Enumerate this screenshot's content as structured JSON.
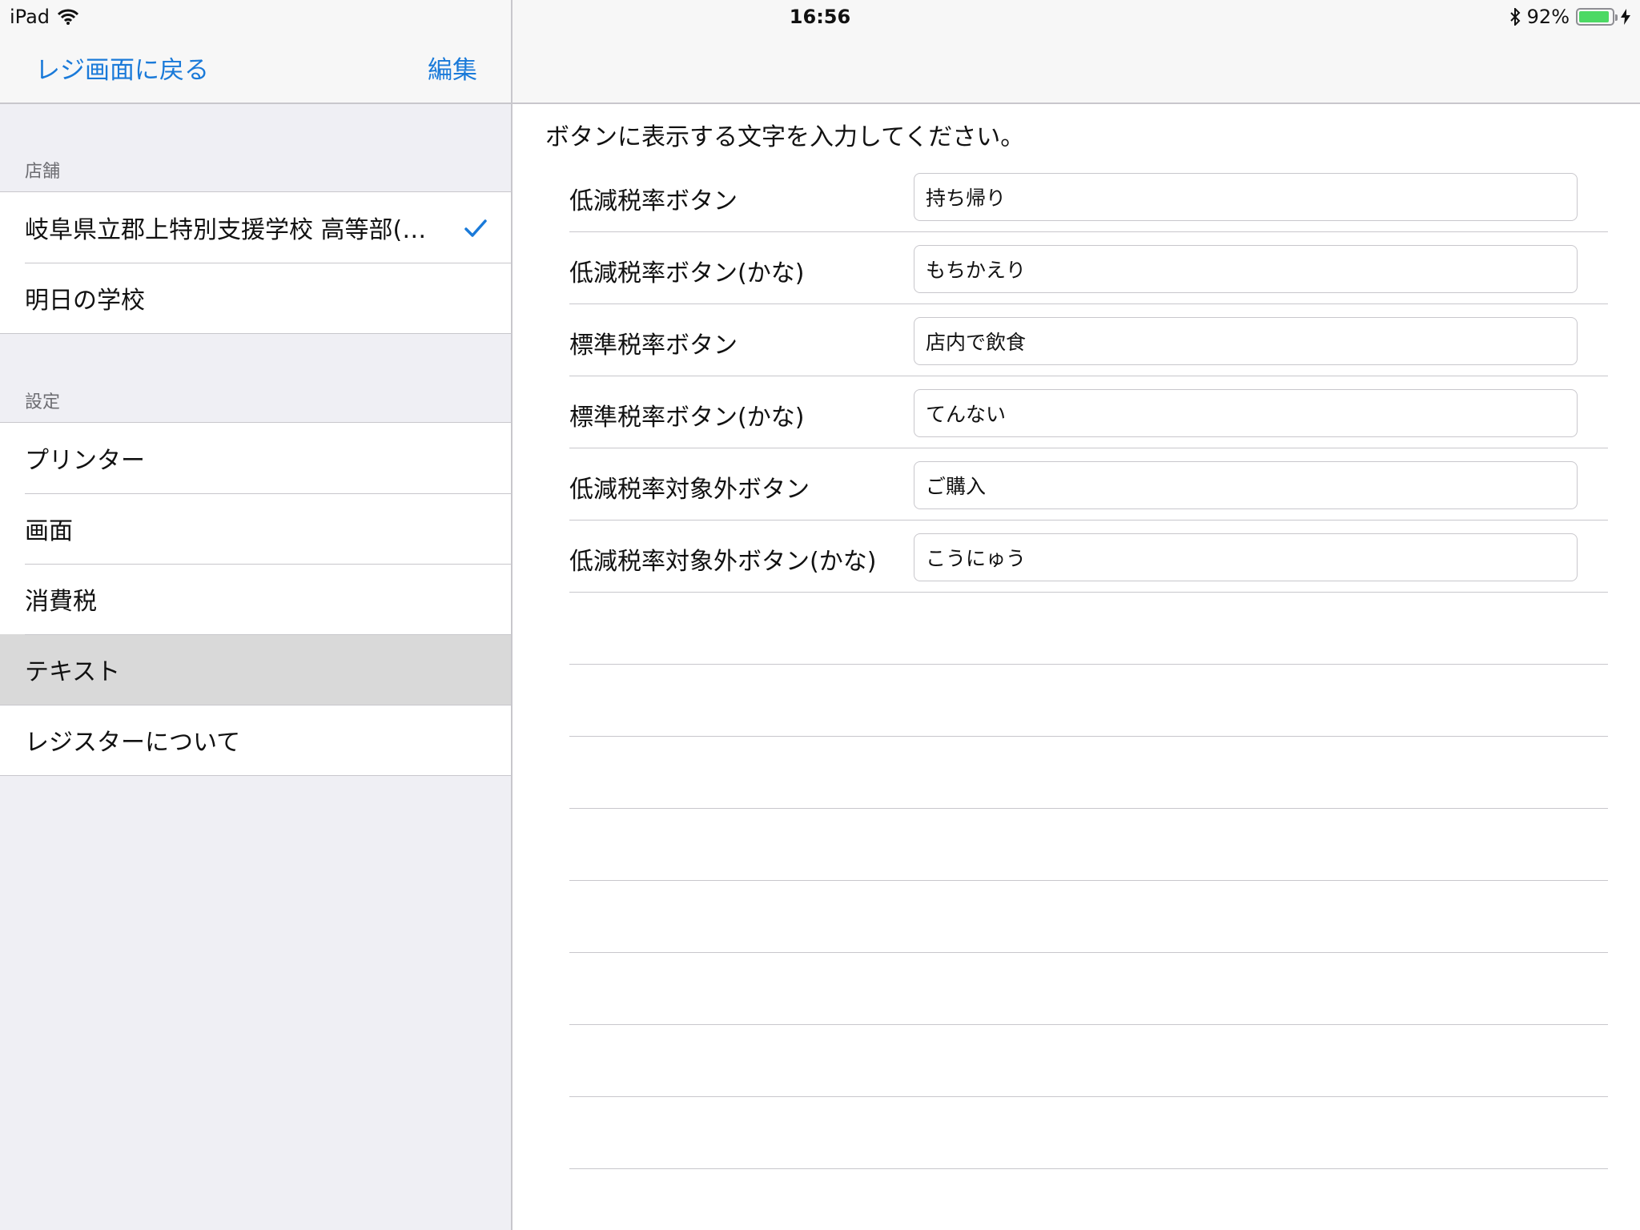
{
  "status_bar": {
    "device": "iPad",
    "time": "16:56",
    "battery_percent": "92%",
    "battery_level": 0.92,
    "icons": [
      "wifi-icon",
      "bluetooth-icon",
      "battery-icon",
      "charging-bolt-icon"
    ],
    "battery_color": "#4cd964"
  },
  "master": {
    "back_label": "レジ画面に戻る",
    "edit_label": "編集",
    "accent_color": "#1a7ad9",
    "stores_header": "店舗",
    "stores": [
      {
        "label": "岐阜県立郡上特別支援学校 高等部(…",
        "checked": true
      },
      {
        "label": "明日の学校",
        "checked": false
      }
    ],
    "settings_header": "設定",
    "settings": [
      {
        "label": "プリンター"
      },
      {
        "label": "画面"
      },
      {
        "label": "消費税"
      },
      {
        "label": "テキスト",
        "selected": true
      },
      {
        "label": "レジスターについて"
      }
    ]
  },
  "detail": {
    "instruction": "ボタンに表示する文字を入力してください。",
    "fields": [
      {
        "label": "低減税率ボタン",
        "value": "持ち帰り"
      },
      {
        "label": "低減税率ボタン(かな)",
        "value": "もちかえり"
      },
      {
        "label": "標準税率ボタン",
        "value": "店内で飲食"
      },
      {
        "label": "標準税率ボタン(かな)",
        "value": "てんない"
      },
      {
        "label": "低減税率対象外ボタン",
        "value": "ご購入"
      },
      {
        "label": "低減税率対象外ボタン(かな)",
        "value": "こうにゅう"
      }
    ]
  }
}
